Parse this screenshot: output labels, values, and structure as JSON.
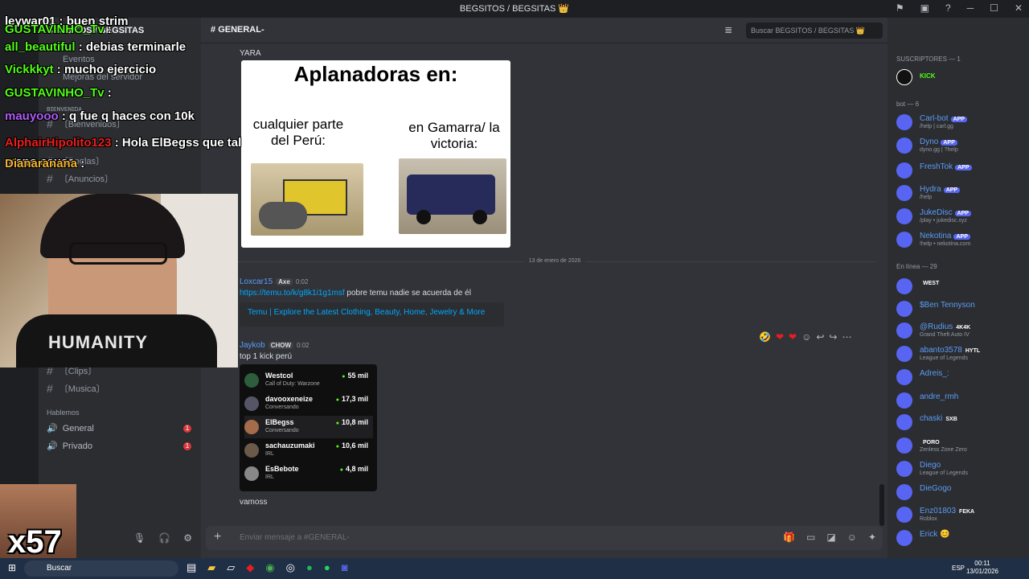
{
  "window": {
    "title": "BEGSITOS / BEGSITAS 👑"
  },
  "channel_sidebar": {
    "server_name": "BEGSITOS / BEGSITAS",
    "events": "Eventos",
    "boosts": "Mejoras del servidor",
    "category_welcome": "ʙɪᴇɴᴠᴇɴɪᴅᴀ",
    "channels": [
      "〔Bienvenidos〕",
      "〔Reglas〕",
      "〔Anuncios〕",
      "〔Clips〕",
      "〔Musica〕"
    ],
    "category_talk": "Hablemos",
    "voice": [
      {
        "label": "General",
        "count": "1"
      },
      {
        "label": "Privado",
        "count": "1"
      }
    ]
  },
  "chat": {
    "channel_name": "GENERAL-",
    "search_placeholder": "Buscar BEGSITOS / BEGSITAS 👑",
    "first_author": "YARA",
    "meme": {
      "title": "Aplanadoras en:",
      "left_caption": "cualquier parte del Perú:",
      "right_caption": "en Gamarra/ la victoria:"
    },
    "date_separator": "13 de enero de 2026",
    "msg1": {
      "author": "Loxcar15",
      "tag": "Axe",
      "time": "0:02",
      "link": "https://temu.to/k/g8k1i1g1msf",
      "text": "pobre temu nadie se acuerda de él",
      "embed": "Temu | Explore the Latest Clothing, Beauty, Home, Jewelry & More"
    },
    "msg2": {
      "author": "Jaykob",
      "tag": "CHOW",
      "time": "0:02",
      "text": "top 1 kick perú"
    },
    "kick_list": [
      {
        "name": "Westcol",
        "sub": "Call of Duty: Warzone",
        "viewers": "55 mil"
      },
      {
        "name": "davooxeneize",
        "sub": "Conversando",
        "viewers": "17,3 mil"
      },
      {
        "name": "ElBegss",
        "sub": "Conversando",
        "viewers": "10,8 mil"
      },
      {
        "name": "sachauzumaki",
        "sub": "IRL",
        "viewers": "10,6 mil"
      },
      {
        "name": "EsBebote",
        "sub": "IRL",
        "viewers": "4,8 mil"
      }
    ],
    "msg3": {
      "text": "vamoss"
    },
    "input_placeholder": "Enviar mensaje a #GENERAL-"
  },
  "members": {
    "subs_header": "SUSCRIPTORES — 1",
    "sub_badge": "KICK",
    "bot_header": "bot — 6",
    "bots": [
      {
        "name": "Carl-bot",
        "sub": "/help | carl.gg",
        "color": "#5c9cf5"
      },
      {
        "name": "Dyno",
        "sub": "dyno.gg | ?help",
        "color": "#5c9cf5"
      },
      {
        "name": "FreshTok",
        "sub": "",
        "color": "#5c9cf5"
      },
      {
        "name": "Hydra",
        "sub": "/help",
        "color": "#5c9cf5"
      },
      {
        "name": "JukeDisc",
        "sub": "/play • jukedisc.xyz",
        "color": "#5c9cf5"
      },
      {
        "name": "Nekotina",
        "sub": "!help • nekotina.com",
        "color": "#5c9cf5"
      }
    ],
    "app_label": "APP",
    "online_header": "En línea — 29",
    "online": [
      {
        "name": "",
        "tag": "WEST",
        "sub": "",
        "color": "#5865f2"
      },
      {
        "name": "$Ben Tennyson",
        "tag": "",
        "sub": "",
        "color": "#5c9cf5"
      },
      {
        "name": "@Rudius",
        "tag": "4K4K",
        "sub": "Grand Theft Auto IV",
        "color": "#5c9cf5"
      },
      {
        "name": "abanto3578",
        "tag": "HYTL",
        "sub": "League of Legends",
        "color": "#5c9cf5"
      },
      {
        "name": "Adreis_:",
        "tag": "",
        "sub": "",
        "color": "#5c9cf5"
      },
      {
        "name": "andre_rmh",
        "tag": "",
        "sub": "",
        "color": "#5c9cf5"
      },
      {
        "name": "chaski",
        "tag": "SXB",
        "sub": "",
        "color": "#5c9cf5"
      },
      {
        "name": "",
        "tag": "PORO",
        "sub": "Zenless Zone Zero",
        "color": "#5865f2"
      },
      {
        "name": "Diego",
        "tag": "",
        "sub": "League of Legends",
        "color": "#5c9cf5"
      },
      {
        "name": "DieGogo",
        "tag": "",
        "sub": "",
        "color": "#5c9cf5"
      },
      {
        "name": "Enz01803",
        "tag": "FEKA",
        "sub": "Roblox",
        "color": "#5c9cf5"
      },
      {
        "name": "Erick 😊",
        "tag": "",
        "sub": "",
        "color": "#5c9cf5"
      }
    ]
  },
  "stream_chat": [
    {
      "user": "leywar01",
      "text": "buen strim",
      "color": "#ffffff"
    },
    {
      "user": "GUSTAVINHO_Tv",
      "text": "",
      "color": "#53fc18"
    },
    {
      "user": "all_beautiful",
      "text": "debias terminarle",
      "color": "#53fc18"
    },
    {
      "user": "Vickkkyt",
      "text": "mucho ejercicio",
      "color": "#53fc18"
    },
    {
      "user": "GUSTAVINHO_Tv",
      "text": "",
      "color": "#53fc18"
    },
    {
      "user": "mauyooo",
      "text": "q fue q haces con 10k",
      "color": "#b05cf5"
    },
    {
      "user": "AlphairHipolito123",
      "text": "Hola ElBegss que tal mano causa",
      "color": "#e91e1e"
    },
    {
      "user": "Dianaranana",
      "text": "",
      "color": "#f0b232"
    }
  ],
  "emote_counter": "x57",
  "taskbar": {
    "search": "Buscar",
    "lang": "ESP",
    "time": "00:11",
    "date": "13/01/2026"
  }
}
